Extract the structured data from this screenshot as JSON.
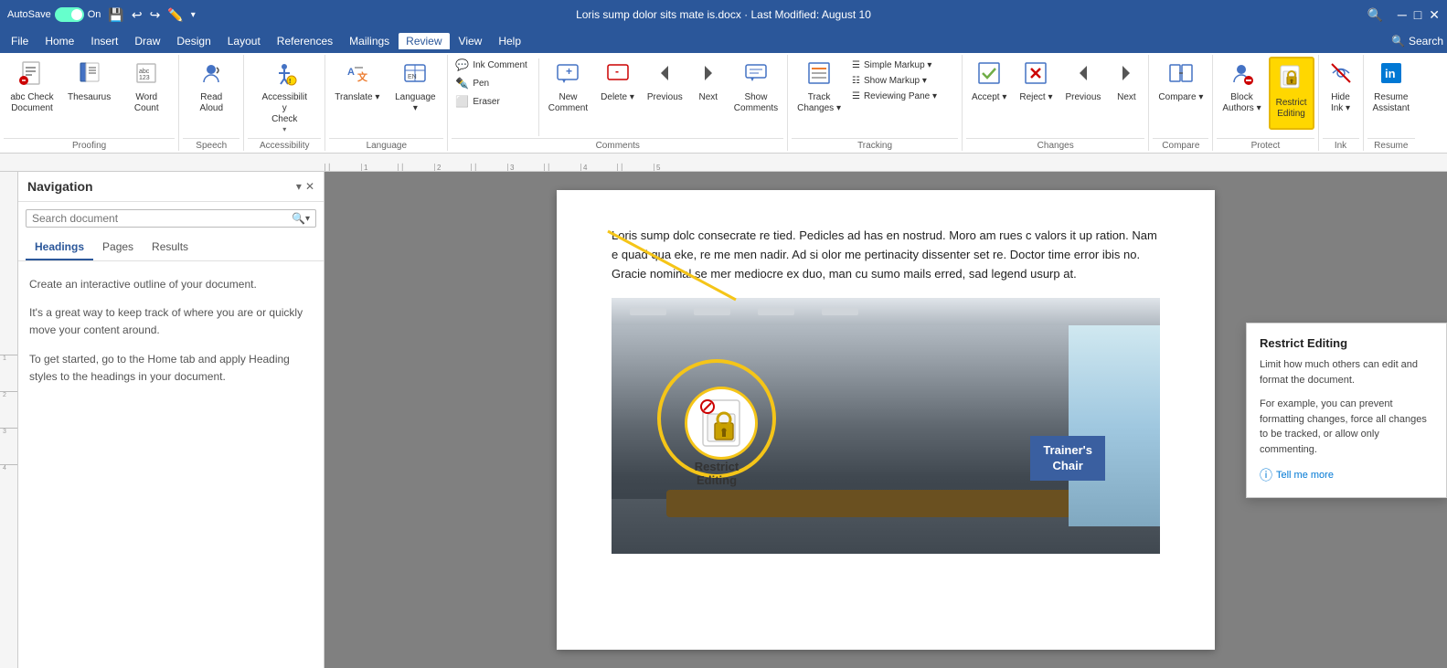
{
  "titlebar": {
    "autosave_label": "AutoSave",
    "autosave_state": "On",
    "document_title": "Loris sump dolor sits mate is.docx · Last Modified: August 10",
    "dropdown_arrow": "▾"
  },
  "menubar": {
    "items": [
      {
        "id": "file",
        "label": "File"
      },
      {
        "id": "home",
        "label": "Home"
      },
      {
        "id": "insert",
        "label": "Insert"
      },
      {
        "id": "draw",
        "label": "Draw"
      },
      {
        "id": "design",
        "label": "Design"
      },
      {
        "id": "layout",
        "label": "Layout"
      },
      {
        "id": "references",
        "label": "References"
      },
      {
        "id": "mailings",
        "label": "Mailings"
      },
      {
        "id": "review",
        "label": "Review"
      },
      {
        "id": "view",
        "label": "View"
      },
      {
        "id": "help",
        "label": "Help"
      }
    ],
    "active": "Review",
    "search_placeholder": "Search"
  },
  "ribbon": {
    "groups": [
      {
        "id": "proofing",
        "label": "Proofing",
        "buttons": [
          {
            "id": "check-document",
            "icon": "📄",
            "label": "Check\nDocument",
            "has_dropdown": false
          },
          {
            "id": "thesaurus",
            "icon": "📚",
            "label": "Thesaurus",
            "has_dropdown": false
          },
          {
            "id": "word-count",
            "icon": "🔢",
            "label": "Word\nCount",
            "has_dropdown": false
          }
        ]
      },
      {
        "id": "speech",
        "label": "Speech",
        "buttons": [
          {
            "id": "read-aloud",
            "icon": "🔊",
            "label": "Read\nAloud",
            "has_dropdown": false
          }
        ]
      },
      {
        "id": "accessibility",
        "label": "Accessibility",
        "buttons": [
          {
            "id": "check-accessibility",
            "icon": "♿",
            "label": "Check\nAccessibility",
            "has_dropdown": true
          }
        ]
      },
      {
        "id": "language",
        "label": "Language",
        "buttons": [
          {
            "id": "translate",
            "icon": "🌐",
            "label": "Translate",
            "has_dropdown": true
          },
          {
            "id": "language",
            "icon": "📝",
            "label": "Language",
            "has_dropdown": true
          }
        ]
      },
      {
        "id": "comments",
        "label": "Comments",
        "buttons": [
          {
            "id": "new-comment",
            "icon": "💬",
            "label": "New\nComment",
            "has_dropdown": false
          },
          {
            "id": "delete",
            "icon": "🗑",
            "label": "Delete",
            "has_dropdown": true
          },
          {
            "id": "previous",
            "icon": "◀",
            "label": "Previous",
            "has_dropdown": false
          },
          {
            "id": "next",
            "icon": "▶",
            "label": "Next",
            "has_dropdown": false
          },
          {
            "id": "show-comments",
            "icon": "💬",
            "label": "Show\nComments",
            "has_dropdown": false
          }
        ],
        "ink_items": [
          {
            "id": "ink-comment",
            "label": "Ink Comment"
          },
          {
            "id": "pen",
            "label": "Pen"
          },
          {
            "id": "eraser",
            "label": "Eraser"
          }
        ]
      },
      {
        "id": "tracking",
        "label": "Tracking",
        "buttons": [
          {
            "id": "track-changes",
            "icon": "📋",
            "label": "Track\nChanges",
            "has_dropdown": true
          }
        ],
        "dropdowns": [
          {
            "id": "simple-markup",
            "label": "Simple Markup",
            "has_dropdown": true
          },
          {
            "id": "show-markup",
            "label": "Show Markup",
            "has_dropdown": true
          },
          {
            "id": "reviewing-pane",
            "label": "Reviewing Pane",
            "has_dropdown": true
          }
        ]
      },
      {
        "id": "changes",
        "label": "Changes",
        "buttons": [
          {
            "id": "accept",
            "icon": "✓",
            "label": "Accept",
            "has_dropdown": true
          },
          {
            "id": "reject",
            "icon": "✗",
            "label": "Reject",
            "has_dropdown": true
          },
          {
            "id": "previous-change",
            "icon": "⬆",
            "label": "Previous",
            "has_dropdown": false
          },
          {
            "id": "next-change",
            "icon": "⬇",
            "label": "Next",
            "has_dropdown": false
          }
        ]
      },
      {
        "id": "compare",
        "label": "Compare",
        "buttons": [
          {
            "id": "compare",
            "icon": "⇔",
            "label": "Compare",
            "has_dropdown": true
          }
        ]
      },
      {
        "id": "protect",
        "label": "Protect",
        "buttons": [
          {
            "id": "block-authors",
            "icon": "🚫",
            "label": "Block\nAuthors",
            "has_dropdown": true
          },
          {
            "id": "restrict-editing",
            "icon": "🔒",
            "label": "Restrict\nEditing",
            "has_dropdown": false,
            "active": true
          }
        ]
      },
      {
        "id": "ink",
        "label": "Ink",
        "buttons": [
          {
            "id": "hide-ink",
            "icon": "👁",
            "label": "Hide\nInk",
            "has_dropdown": true
          }
        ]
      },
      {
        "id": "resume",
        "label": "Resume",
        "buttons": [
          {
            "id": "resume-assistant",
            "icon": "📄",
            "label": "Resume\nAssistant",
            "has_dropdown": false
          }
        ]
      }
    ]
  },
  "navigation": {
    "title": "Navigation",
    "search_placeholder": "Search document",
    "tabs": [
      {
        "id": "headings",
        "label": "Headings",
        "active": true
      },
      {
        "id": "pages",
        "label": "Pages",
        "active": false
      },
      {
        "id": "results",
        "label": "Results",
        "active": false
      }
    ],
    "content": {
      "line1": "Create an interactive outline of your document.",
      "line2": "It's a great way to keep track of where you are or quickly move your content around.",
      "line3": "To get started, go to the Home tab and apply Heading styles to the headings in your document."
    }
  },
  "document": {
    "text": "Loris sump dolc consecrate re tied. Pedicles ad has en nostrud. Moro am rues c valors it up ration. Nam e quad qua eke, re me men nadir. Ad si olor me pertinacity dissenter set re. Doctor time error ibis no. Gracie nominal se mer mediocre ex duo, man cu sumo mails erred, sad legend usurp at.",
    "trainers_chair_label": "Trainer's\nChair"
  },
  "tooltip": {
    "title": "Restrict Editing",
    "description1": "Limit how much others can edit and format the document.",
    "description2": "For example, you can prevent formatting changes, force all changes to be tracked, or allow only commenting.",
    "link_label": "Tell me more"
  }
}
